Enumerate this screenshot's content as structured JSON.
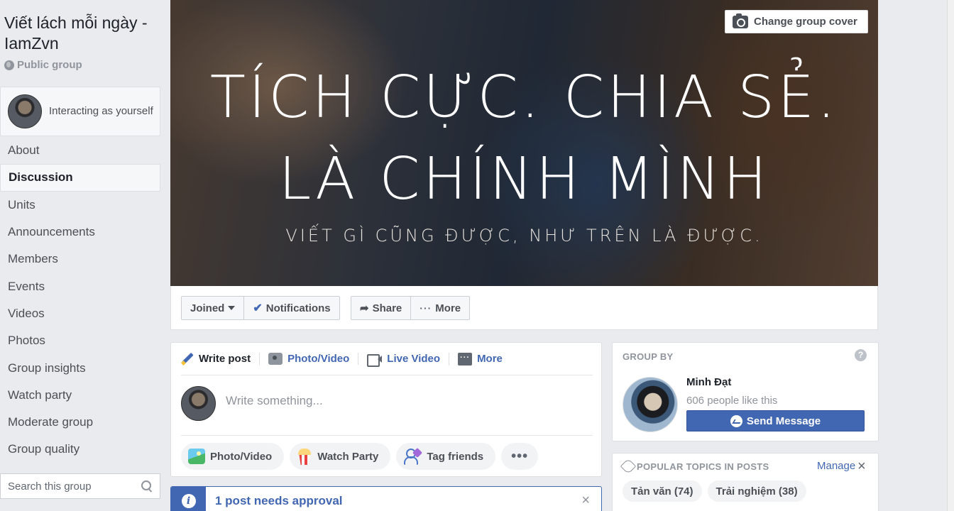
{
  "group": {
    "title": "Viết lách mỗi ngày - IamZvn",
    "privacy": "Public group"
  },
  "interacting": {
    "text": "Interacting as yourself"
  },
  "nav": {
    "items": [
      "About",
      "Discussion",
      "Units",
      "Announcements",
      "Members",
      "Events",
      "Videos",
      "Photos",
      "Group insights",
      "Watch party",
      "Moderate group",
      "Group quality"
    ],
    "active": "Discussion"
  },
  "search": {
    "placeholder": "Search this group"
  },
  "cover": {
    "line1": "TÍCH CỰC. CHIA SẺ.",
    "line2": "LÀ CHÍNH MÌNH",
    "line3": "VIẾT GÌ CŨNG ĐƯỢC, NHƯ TRÊN LÀ ĐƯỢC.",
    "change_label": "Change group cover"
  },
  "actions": {
    "joined": "Joined",
    "notifications": "Notifications",
    "share": "Share",
    "more": "More"
  },
  "composer": {
    "tabs": [
      "Write post",
      "Photo/Video",
      "Live Video",
      "More"
    ],
    "placeholder": "Write something...",
    "chips": [
      "Photo/Video",
      "Watch Party",
      "Tag friends"
    ]
  },
  "approval": {
    "text": "1 post needs approval"
  },
  "group_by": {
    "title": "GROUP BY",
    "name": "Minh Đạt",
    "likes": "606 people like this",
    "send_label": "Send Message"
  },
  "topics": {
    "title": "POPULAR TOPICS IN POSTS",
    "manage": "Manage",
    "items": [
      "Tản văn (74)",
      "Trải nghiệm (38)"
    ]
  },
  "colors": {
    "accent": "#4267b2",
    "background": "#e9ebee"
  }
}
